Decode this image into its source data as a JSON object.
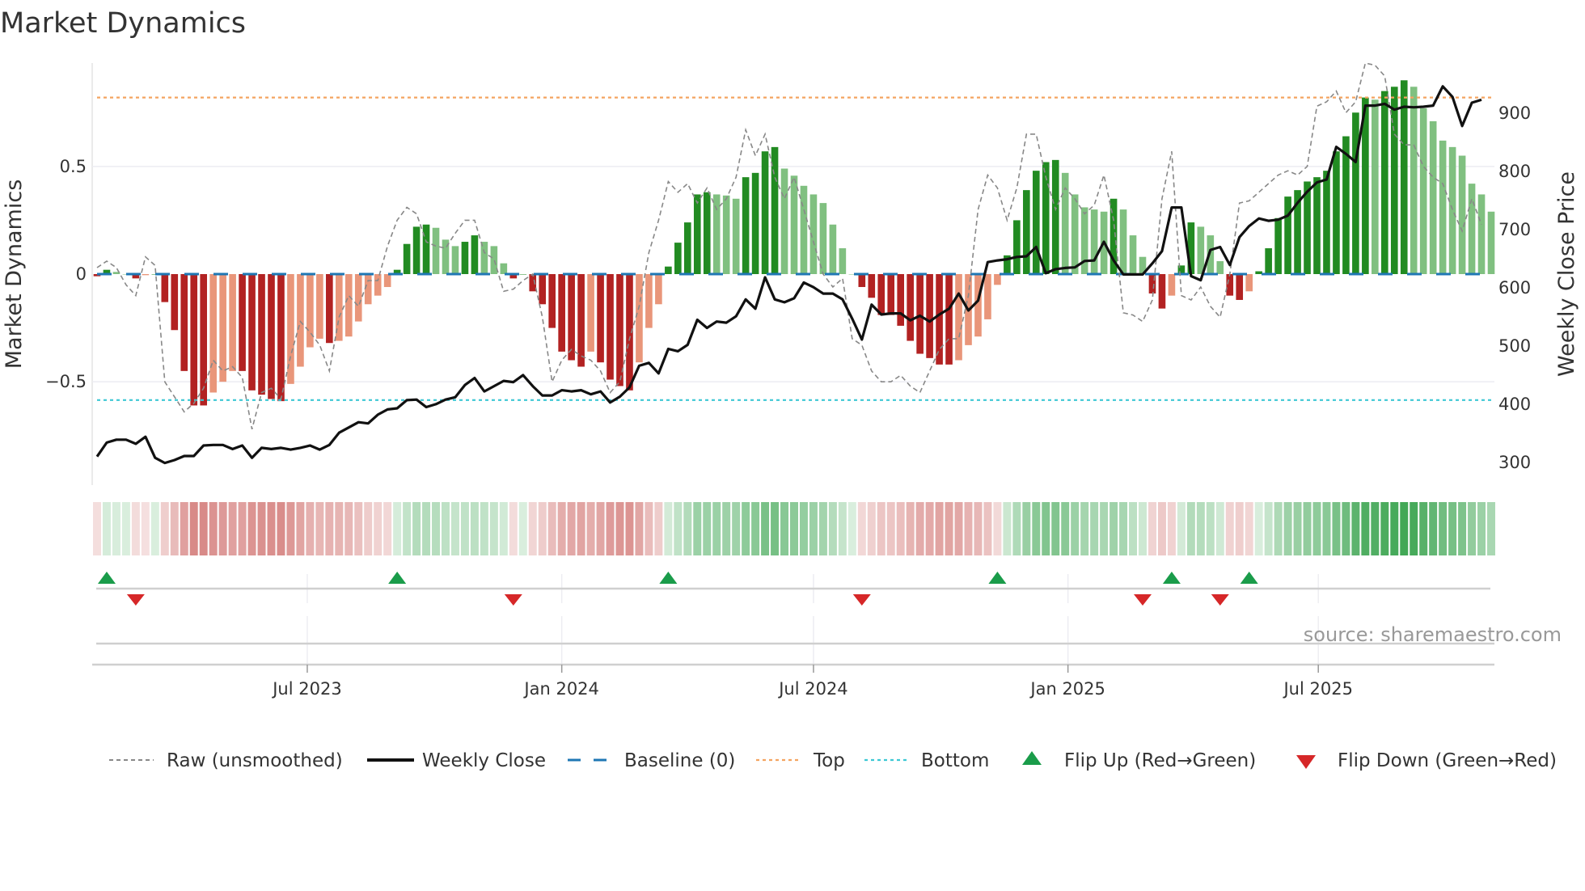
{
  "title": "Market Dynamics",
  "source": "source: sharemaestro.com",
  "chart_data": {
    "type": "bar+line",
    "title": "Market Dynamics",
    "start_week": "2023-01-30",
    "frequency": "weekly",
    "momentum": [
      -0.01,
      0.02,
      0.01,
      0.0,
      -0.02,
      -0.005,
      0.0,
      -0.13,
      -0.26,
      -0.45,
      -0.61,
      -0.61,
      -0.55,
      -0.5,
      -0.45,
      -0.45,
      -0.54,
      -0.56,
      -0.58,
      -0.59,
      -0.51,
      -0.43,
      -0.34,
      -0.3,
      -0.32,
      -0.31,
      -0.29,
      -0.22,
      -0.14,
      -0.1,
      -0.06,
      0.02,
      0.14,
      0.22,
      0.23,
      0.215,
      0.16,
      0.13,
      0.15,
      0.18,
      0.15,
      0.13,
      0.05,
      -0.02,
      0.0,
      -0.08,
      -0.14,
      -0.25,
      -0.36,
      -0.4,
      -0.43,
      -0.36,
      -0.41,
      -0.49,
      -0.52,
      -0.54,
      -0.41,
      -0.25,
      -0.14,
      0.035,
      0.146,
      0.24,
      0.37,
      0.38,
      0.37,
      0.365,
      0.35,
      0.45,
      0.47,
      0.57,
      0.59,
      0.49,
      0.457,
      0.41,
      0.37,
      0.33,
      0.23,
      0.12,
      0.0,
      -0.06,
      -0.11,
      -0.19,
      -0.19,
      -0.24,
      -0.31,
      -0.37,
      -0.39,
      -0.42,
      -0.42,
      -0.4,
      -0.33,
      -0.29,
      -0.21,
      -0.05,
      0.087,
      0.25,
      0.39,
      0.48,
      0.52,
      0.53,
      0.47,
      0.37,
      0.31,
      0.3,
      0.29,
      0.35,
      0.3,
      0.18,
      0.08,
      -0.09,
      -0.16,
      -0.1,
      0.04,
      0.24,
      0.22,
      0.18,
      0.06,
      -0.1,
      -0.12,
      -0.08,
      0.013,
      0.12,
      0.26,
      0.36,
      0.39,
      0.43,
      0.45,
      0.48,
      0.57,
      0.64,
      0.75,
      0.82,
      0.81,
      0.85,
      0.87,
      0.9,
      0.87,
      0.77,
      0.71,
      0.62,
      0.59,
      0.55,
      0.42,
      0.37,
      0.29
    ],
    "raw": [
      0.03,
      0.06,
      0.03,
      -0.05,
      -0.1,
      0.08,
      0.04,
      -0.5,
      -0.57,
      -0.64,
      -0.6,
      -0.53,
      -0.4,
      -0.45,
      -0.43,
      -0.48,
      -0.72,
      -0.55,
      -0.53,
      -0.58,
      -0.38,
      -0.22,
      -0.27,
      -0.33,
      -0.45,
      -0.2,
      -0.1,
      -0.15,
      -0.03,
      -0.03,
      0.13,
      0.25,
      0.31,
      0.28,
      0.15,
      0.13,
      0.12,
      0.19,
      0.25,
      0.25,
      0.1,
      0.07,
      -0.08,
      -0.07,
      -0.03,
      0.0,
      -0.2,
      -0.5,
      -0.4,
      -0.35,
      -0.38,
      -0.4,
      -0.45,
      -0.55,
      -0.5,
      -0.3,
      -0.15,
      0.1,
      0.25,
      0.43,
      0.38,
      0.42,
      0.33,
      0.4,
      0.3,
      0.35,
      0.45,
      0.67,
      0.55,
      0.65,
      0.45,
      0.35,
      0.45,
      0.3,
      0.15,
      0.0,
      -0.06,
      -0.02,
      -0.3,
      -0.33,
      -0.45,
      -0.5,
      -0.5,
      -0.47,
      -0.52,
      -0.55,
      -0.45,
      -0.35,
      -0.3,
      -0.3,
      -0.1,
      0.3,
      0.46,
      0.4,
      0.25,
      0.4,
      0.65,
      0.65,
      0.45,
      0.3,
      0.4,
      0.35,
      0.28,
      0.32,
      0.46,
      0.25,
      -0.18,
      -0.19,
      -0.22,
      -0.12,
      0.35,
      0.57,
      -0.1,
      -0.12,
      -0.06,
      -0.15,
      -0.2,
      0.0,
      0.33,
      0.34,
      0.38,
      0.42,
      0.46,
      0.48,
      0.46,
      0.5,
      0.78,
      0.8,
      0.85,
      0.75,
      0.8,
      0.98,
      0.97,
      0.92,
      0.65,
      0.6,
      0.6,
      0.5,
      0.45,
      0.42,
      0.3,
      0.2,
      0.35,
      0.23
    ],
    "close": [
      309,
      333,
      338,
      338,
      331,
      343,
      307,
      298,
      303,
      310,
      310,
      328,
      329,
      329,
      322,
      328,
      307,
      324,
      322,
      324,
      321,
      324,
      328,
      321,
      329,
      350,
      359,
      368,
      366,
      381,
      390,
      392,
      406,
      407,
      394,
      399,
      407,
      411,
      432,
      444,
      421,
      430,
      439,
      437,
      449,
      430,
      414,
      414,
      423,
      421,
      423,
      416,
      421,
      402,
      412,
      428,
      465,
      470,
      452,
      494,
      490,
      501,
      544,
      530,
      541,
      539,
      550,
      579,
      563,
      617,
      579,
      574,
      581,
      608,
      600,
      589,
      589,
      579,
      546,
      510,
      570,
      553,
      555,
      555,
      543,
      551,
      541,
      553,
      563,
      589,
      560,
      577,
      643,
      646,
      648,
      652,
      653,
      669,
      624,
      631,
      633,
      634,
      645,
      646,
      678,
      646,
      622,
      622,
      622,
      641,
      662,
      737,
      737,
      619,
      612,
      664,
      669,
      638,
      686,
      705,
      718,
      714,
      716,
      723,
      745,
      764,
      780,
      785,
      841,
      829,
      815,
      912,
      912,
      915,
      905,
      910,
      909,
      910,
      912,
      945,
      927,
      877,
      917,
      922
    ],
    "baseline": 0,
    "top_level": 0.82,
    "bottom_level": -0.585,
    "flip_up_weeks": [
      1,
      31,
      59,
      93,
      111,
      119
    ],
    "flip_down_weeks": [
      4,
      43,
      79,
      108,
      116
    ],
    "y_left": {
      "label": "Market Dynamics",
      "range": [
        -0.98,
        0.98
      ],
      "ticks": [
        {
          "value": 0.5,
          "label": "0.5"
        },
        {
          "value": 0,
          "label": "0"
        },
        {
          "value": -0.5,
          "label": "−0.5"
        }
      ]
    },
    "y_right": {
      "label": "Weekly Close Price",
      "range": [
        260,
        985
      ],
      "ticks": [
        {
          "value": 900,
          "label": "900"
        },
        {
          "value": 800,
          "label": "800"
        },
        {
          "value": 700,
          "label": "700"
        },
        {
          "value": 600,
          "label": "600"
        },
        {
          "value": 500,
          "label": "500"
        },
        {
          "value": 400,
          "label": "400"
        },
        {
          "value": 300,
          "label": "300"
        }
      ]
    },
    "x_ticks": [
      {
        "date": "2023-07-01",
        "label": "Jul 2023"
      },
      {
        "date": "2024-01-01",
        "label": "Jan 2024"
      },
      {
        "date": "2024-07-01",
        "label": "Jul 2024"
      },
      {
        "date": "2025-01-01",
        "label": "Jan 2025"
      },
      {
        "date": "2025-07-01",
        "label": "Jul 2025"
      }
    ],
    "legend": [
      {
        "kind": "raw",
        "label": "Raw (unsmoothed)"
      },
      {
        "kind": "close",
        "label": "Weekly Close"
      },
      {
        "kind": "baseline",
        "label": "Baseline (0)"
      },
      {
        "kind": "top",
        "label": "Top"
      },
      {
        "kind": "bottom",
        "label": "Bottom"
      },
      {
        "kind": "flip-up",
        "label": "Flip Up (Red→Green)"
      },
      {
        "kind": "flip-down",
        "label": "Flip Down (Green→Red)"
      }
    ],
    "colors": {
      "pos_rising": "#228b22",
      "pos_falling": "#80c080",
      "neg_falling": "#b22222",
      "neg_rising": "#e9967a",
      "close": "#111111",
      "raw": "#888888",
      "baseline": "#1f77b4",
      "top": "#f4a460",
      "bottom": "#3cc8d4",
      "flip_up": "#1a9c4a",
      "flip_down": "#d62728",
      "heat_green": "#2e9e44",
      "heat_red": "#c5504d"
    }
  }
}
